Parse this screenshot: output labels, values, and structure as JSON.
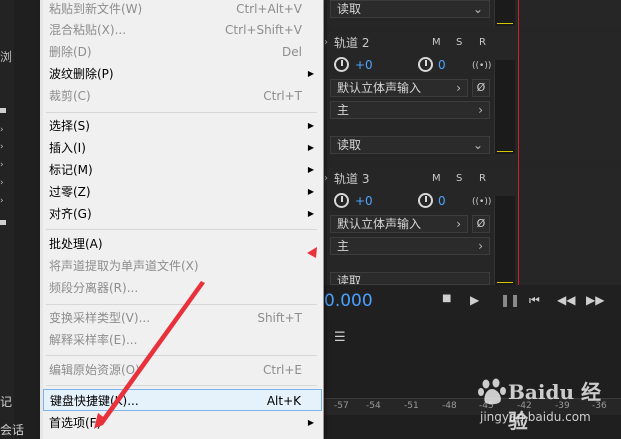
{
  "left_panel": {
    "tab_fragment": "浏",
    "bottom_text_1": "记",
    "bottom_text_2": "会话"
  },
  "menu": {
    "items": [
      {
        "label": "粘贴到新文件(W)",
        "shortcut": "Ctrl+Alt+V",
        "enabled": false
      },
      {
        "label": "混合粘贴(X)...",
        "shortcut": "Ctrl+Shift+V",
        "enabled": false
      },
      {
        "label": "删除(D)",
        "shortcut": "Del",
        "enabled": false
      },
      {
        "label": "波纹删除(P)",
        "shortcut": "",
        "enabled": true,
        "submenu": true
      },
      {
        "label": "裁剪(C)",
        "shortcut": "Ctrl+T",
        "enabled": false
      },
      {
        "label": "选择(S)",
        "shortcut": "",
        "enabled": true,
        "submenu": true
      },
      {
        "label": "插入(I)",
        "shortcut": "",
        "enabled": true,
        "submenu": true
      },
      {
        "label": "标记(M)",
        "shortcut": "",
        "enabled": true,
        "submenu": true
      },
      {
        "label": "过零(Z)",
        "shortcut": "",
        "enabled": true,
        "submenu": true
      },
      {
        "label": "对齐(G)",
        "shortcut": "",
        "enabled": true,
        "submenu": true
      },
      {
        "label": "批处理(A)",
        "shortcut": "",
        "enabled": true
      },
      {
        "label": "将声道提取为单声道文件(X)",
        "shortcut": "",
        "enabled": false
      },
      {
        "label": "频段分离器(R)...",
        "shortcut": "",
        "enabled": false
      },
      {
        "label": "变换采样类型(V)...",
        "shortcut": "Shift+T",
        "enabled": false
      },
      {
        "label": "解释采样率(E)...",
        "shortcut": "",
        "enabled": false
      },
      {
        "label": "编辑原始资源(O)",
        "shortcut": "Ctrl+E",
        "enabled": false
      },
      {
        "label": "键盘快捷键(K)...",
        "shortcut": "Alt+K",
        "enabled": true,
        "highlighted": true
      },
      {
        "label": "首选项(F)",
        "shortcut": "",
        "enabled": true,
        "submenu": true
      }
    ]
  },
  "tracks": [
    {
      "name": "",
      "read_mode": "读取"
    },
    {
      "name": "轨道 2",
      "volume": "+0",
      "pan": "0",
      "input": "默认立体声输入",
      "output": "主",
      "read_mode": "读取"
    },
    {
      "name": "轨道 3",
      "volume": "+0",
      "pan": "0",
      "input": "默认立体声输入",
      "output": "主",
      "read_mode": "读取"
    }
  ],
  "track_labels": {
    "m": "M",
    "s": "S",
    "r": "R",
    "i": "I",
    "wave": "((•))",
    "phase": "Ø"
  },
  "transport": {
    "time": "0.000"
  },
  "ruler": {
    "ticks": [
      "-57",
      "-54",
      "-51",
      "-48",
      "-45",
      "-42",
      "-39",
      "-36"
    ]
  },
  "watermark": {
    "brand": "Baidu 经验",
    "url": "jingyan.baidu.com"
  },
  "colors": {
    "accent_blue": "#4aa0ff",
    "playhead_red": "#c8232c",
    "arrow_red": "#e8313b",
    "menu_bg": "#f0f0f0",
    "highlight_bg": "#e5f1fb"
  }
}
